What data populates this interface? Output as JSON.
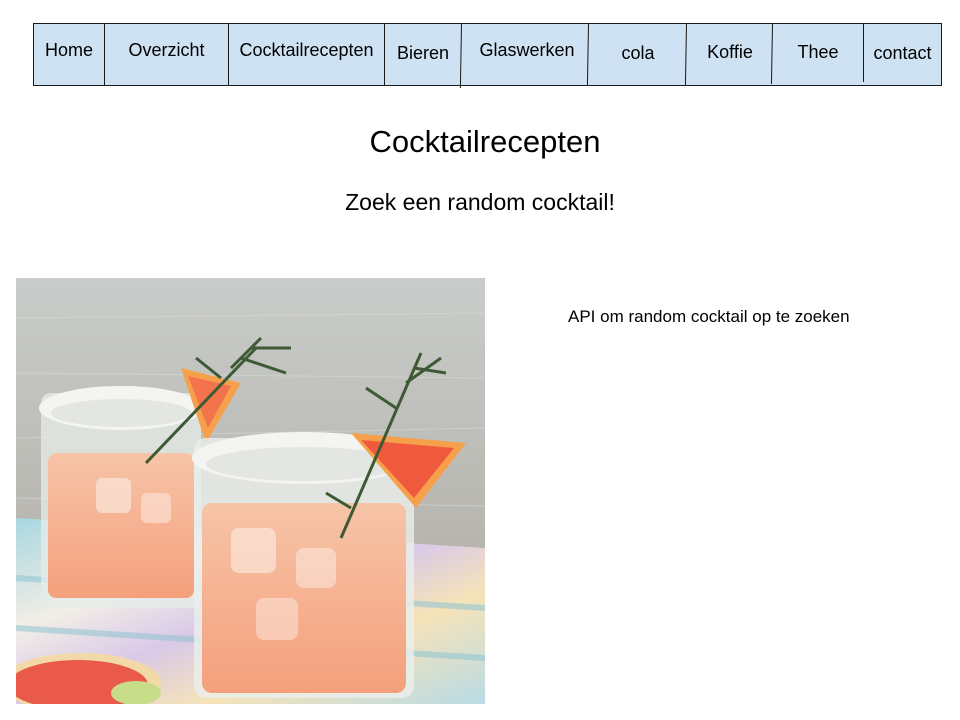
{
  "nav": {
    "items": [
      {
        "label": "Home"
      },
      {
        "label": "Overzicht"
      },
      {
        "label": "Cocktailrecepten"
      },
      {
        "label": "Bieren"
      },
      {
        "label": "Glaswerken"
      },
      {
        "label": "cola"
      },
      {
        "label": "Koffie"
      },
      {
        "label": "Thee"
      },
      {
        "label": "contact"
      }
    ]
  },
  "main": {
    "title": "Cocktailrecepten",
    "subtitle": "Zoek een random cocktail!",
    "note": "API om random cocktail op te zoeken"
  },
  "colors": {
    "nav_background": "#cfe2f3",
    "nav_border": "#1a1a1a"
  }
}
